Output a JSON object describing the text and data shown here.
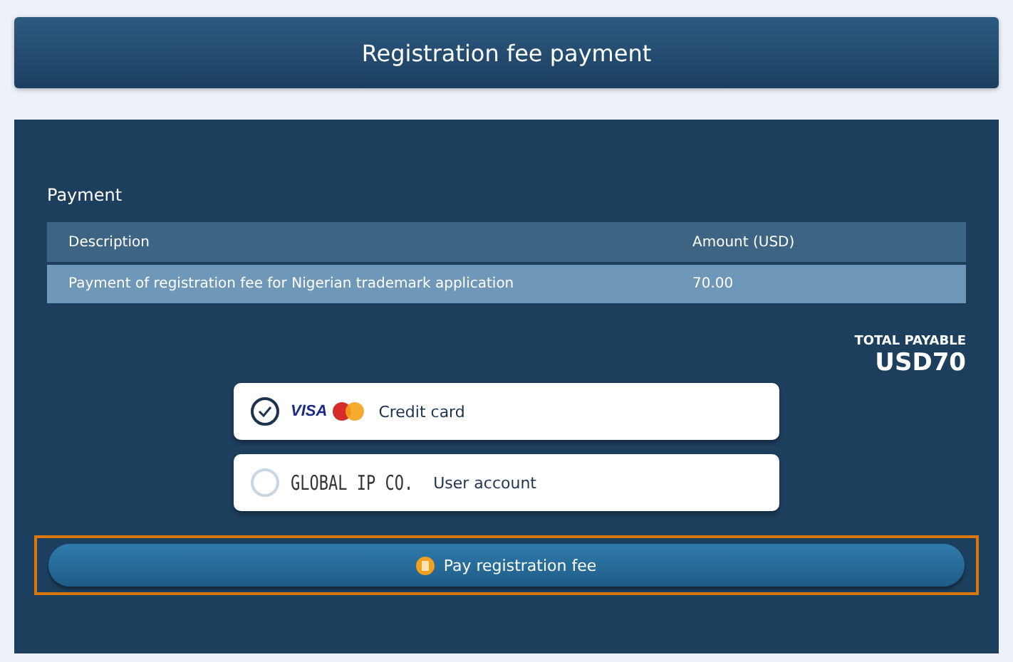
{
  "header": {
    "title": "Registration fee payment"
  },
  "section": {
    "title": "Payment"
  },
  "table": {
    "columns": [
      "Description",
      "Amount (USD)"
    ],
    "rows": [
      [
        "Payment of registration fee for Nigerian trademark application",
        "70.00"
      ]
    ]
  },
  "total": {
    "label": "TOTAL PAYABLE",
    "value": "USD70"
  },
  "payment_options": [
    {
      "kind": "card",
      "logo": "VISA",
      "label": "Credit card",
      "selected": true
    },
    {
      "kind": "account",
      "logo": "GLOBAL IP CO.",
      "label": "User account",
      "selected": false
    }
  ],
  "pay_button": {
    "label": "Pay registration fee",
    "focused": true
  }
}
